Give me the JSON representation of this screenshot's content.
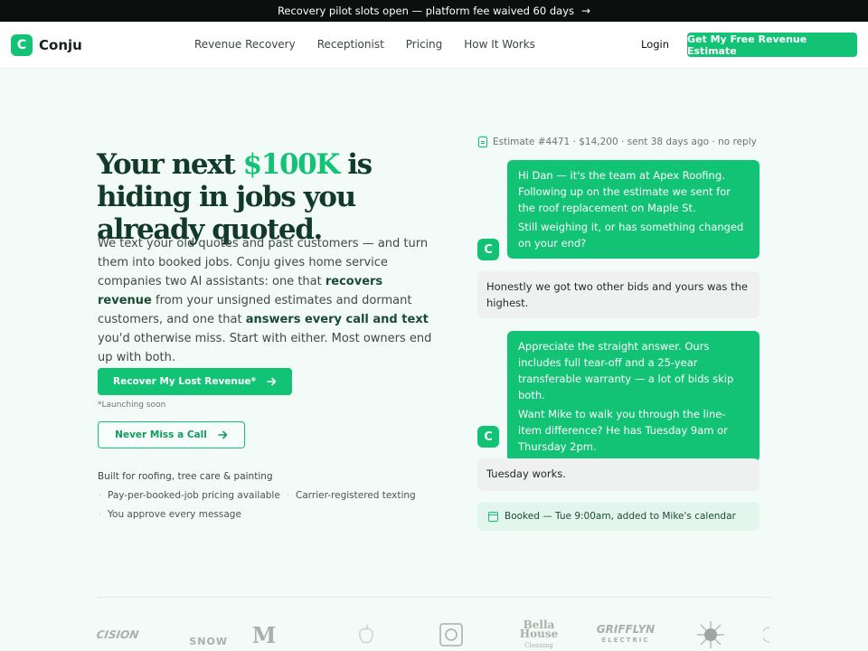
{
  "banner": {
    "text": "Recovery pilot slots open — platform fee waived 60 days",
    "arrow": "→"
  },
  "nav": {
    "logo_letter": "C",
    "brand": "Conju",
    "links": [
      "Revenue Recovery",
      "Receptionist",
      "Pricing",
      "How It Works"
    ],
    "login": "Login",
    "cta": "Get My Free Revenue Estimate"
  },
  "hero": {
    "headline_pre": "Your next ",
    "headline_accent": "$100K",
    "headline_post": " is hiding in jobs you already quoted.",
    "lede_1": "We text your old quotes and past customers — and turn them into booked jobs. Conju gives home service companies two AI assistants: one that ",
    "lede_b1": "recovers revenue",
    "lede_2": " from your unsigned estimates and dormant customers, and one that ",
    "lede_b2": "answers every call and text",
    "lede_3": " you'd otherwise miss. Start with either. Most owners end up with both.",
    "primary_cta": "Recover My Lost Revenue*",
    "launch_note": "*Launching soon",
    "secondary_cta": "Never Miss a Call",
    "built_for": "Built for roofing, tree care & painting",
    "bullets": [
      "Pay-per-booked-job pricing available",
      "Carrier-registered texting",
      "You approve every message"
    ]
  },
  "chat": {
    "estimate_meta": "Estimate #4471 · $14,200 · sent 38 days ago · no reply",
    "avatar_letter": "C",
    "msg1_p1": "Hi Dan — it's the team at Apex Roofing. Following up on the estimate we sent for the roof replacement on Maple St.",
    "msg1_p2": "Still weighing it, or has something changed on your end?",
    "reply1": "Honestly we got two other bids and yours was the highest.",
    "msg2_p1": "Appreciate the straight answer. Ours includes full tear-off and a 25-year transferable warranty — a lot of bids skip both.",
    "msg2_p2": "Want Mike to walk you through the line-item difference? He has Tuesday 9am or Thursday 2pm.",
    "reply2": "Tuesday works.",
    "booked": "Booked — Tue 9:00am, added to Mike's calendar"
  },
  "partners": {
    "p1": "CISION",
    "p2": "SNOW",
    "p3": "M",
    "p5": "",
    "p6": "Bella House",
    "p6b": "Cleaning",
    "p7": "GRIFFLYN",
    "p7b": "ELECTRIC"
  },
  "colors": {
    "accent": "#12c275",
    "headline": "#123a2a",
    "banner": "#0b0f0d"
  }
}
